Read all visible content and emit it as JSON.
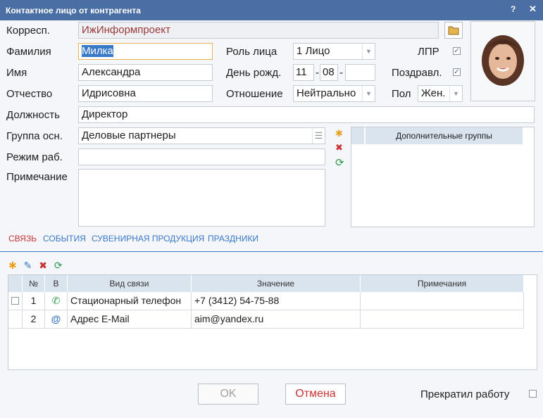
{
  "window": {
    "title": "Контактное лицо от контрагента",
    "help": "?",
    "close": "✕"
  },
  "form": {
    "corresp_label": "Корресп.",
    "corresp_value": "ИжИнформпроект",
    "lastname_label": "Фамилия",
    "lastname_value": "Милка",
    "firstname_label": "Имя",
    "firstname_value": "Александра",
    "patronymic_label": "Отчество",
    "patronymic_value": "Идрисовна",
    "role_label": "Роль лица",
    "role_value": "1 Лицо",
    "birthday_label": "День рожд.",
    "birthday_day": "11",
    "birthday_month": "08",
    "birthday_year": "",
    "relation_label": "Отношение",
    "relation_value": "Нейтрально",
    "lpr_label": "ЛПР",
    "congrats_label": "Поздравл.",
    "gender_label": "Пол",
    "gender_value": "Жен.",
    "position_label": "Должность",
    "position_value": "Директор",
    "group_label": "Группа осн.",
    "group_value": "Деловые партнеры",
    "workmode_label": "Режим раб.",
    "workmode_value": "",
    "note_label": "Примечание",
    "note_value": "",
    "extra_groups_header": "Дополнительные группы"
  },
  "tabs": [
    "СВЯЗЬ",
    "СОБЫТИЯ",
    "СУВЕНИРНАЯ ПРОДУКЦИЯ",
    "ПРАЗДНИКИ"
  ],
  "grid": {
    "headers": [
      "№",
      "В",
      "Вид связи",
      "Значение",
      "Примечания"
    ],
    "rows": [
      {
        "num": "1",
        "type": "Стационарный телефон",
        "value": "+7 (3412) 54-75-88",
        "note": "",
        "icon": "phone-icon"
      },
      {
        "num": "2",
        "type": "Адрес E-Mail",
        "value": "aim@yandex.ru",
        "note": "",
        "icon": "email-icon"
      }
    ]
  },
  "footer": {
    "ok": "OK",
    "cancel": "Отмена",
    "stopped_label": "Прекратил работу"
  },
  "colors": {
    "titlebar": "#4a6fa5",
    "accent": "#3a78c8",
    "active_tab": "#c83232",
    "grid_header": "#d9e4ef"
  }
}
